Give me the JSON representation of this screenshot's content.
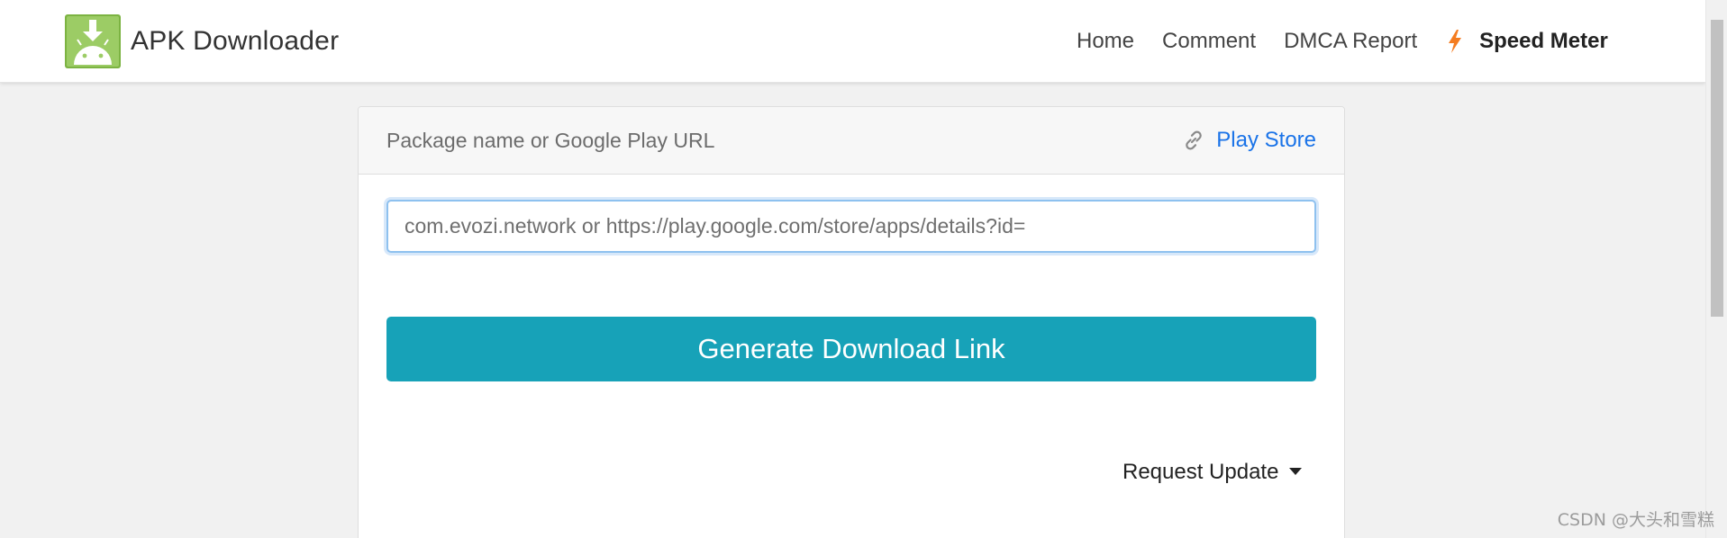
{
  "brand": {
    "name": "APK Downloader",
    "logo_icon": "android-download-icon"
  },
  "nav": {
    "items": [
      {
        "label": "Home"
      },
      {
        "label": "Comment"
      },
      {
        "label": "DMCA Report"
      }
    ],
    "speed_meter": {
      "label": "Speed Meter",
      "icon": "lightning-icon",
      "icon_color": "#f47c20"
    }
  },
  "card": {
    "header_title": "Package name or Google Play URL",
    "store_link": {
      "label": "Play Store",
      "icon": "link-icon",
      "color": "#1a73e8"
    },
    "input": {
      "value": "",
      "placeholder": "com.evozi.network or https://play.google.com/store/apps/details?id="
    },
    "generate_button": {
      "label": "Generate Download Link",
      "color": "#17a2b8"
    },
    "request_update": {
      "label": "Request Update"
    }
  },
  "watermark": "CSDN @大头和雪糕",
  "colors": {
    "page_bg": "#f1f1f1",
    "logo_green": "#8bc34a"
  }
}
